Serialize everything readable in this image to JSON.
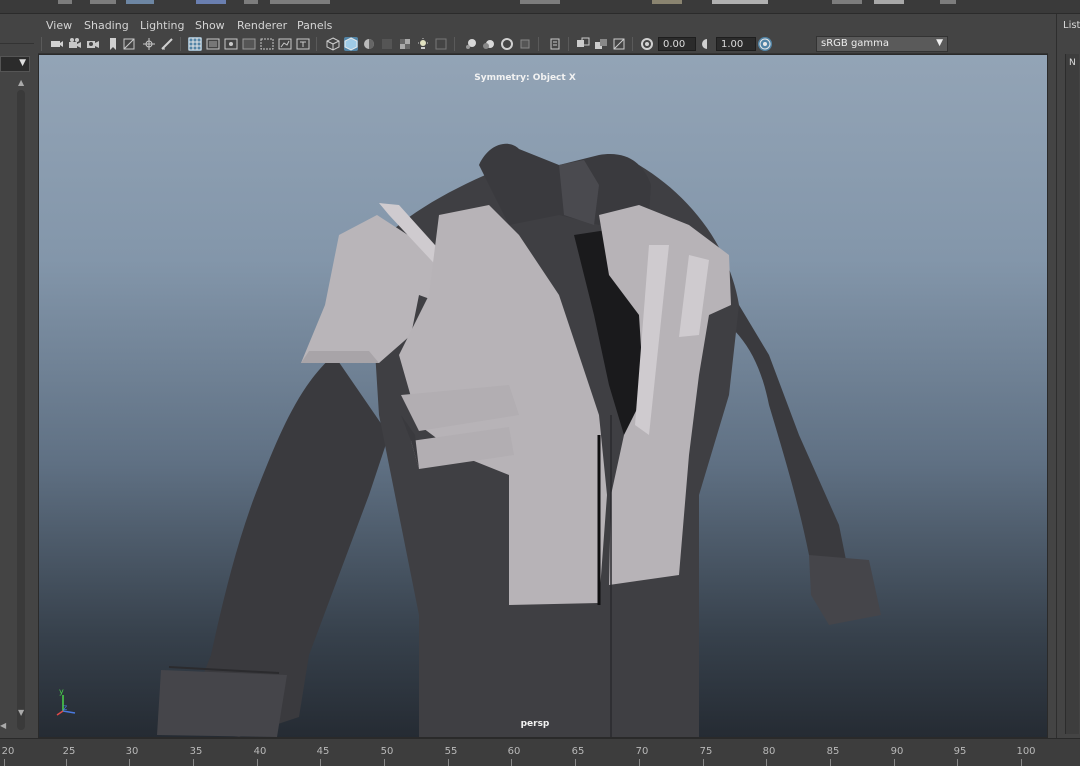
{
  "viewport_panel": {
    "menu": [
      "View",
      "Shading",
      "Lighting",
      "Show",
      "Renderer",
      "Panels"
    ],
    "toolbar": {
      "icons": [
        "select-camera-icon",
        "camera-attributes-icon",
        "bookmark-icon",
        "camera-icon",
        "image-plane-icon",
        "2d-pan-zoom-icon",
        "grease-pencil-icon",
        "grid-icon",
        "film-gate-icon",
        "resolution-gate-icon",
        "gate-mask-icon",
        "field-chart-icon",
        "safe-action-icon",
        "safe-title-icon",
        "wireframe-icon",
        "smooth-shade-icon",
        "default-lighting-icon",
        "textured-icon",
        "use-all-lights-icon",
        "shadows-icon",
        "screen-space-ao-icon",
        "motion-blur-icon",
        "multisample-aa-icon",
        "depth-of-field-icon",
        "isolate-select-icon",
        "xray-icon",
        "xray-joints-icon",
        "backface-culling-icon",
        "exposure-icon",
        "gamma-icon",
        "color-management-icon"
      ],
      "exposure_value": "0.00",
      "gamma_value": "1.00",
      "color_space": "sRGB gamma"
    },
    "symmetry_label": "Symmetry: Object X",
    "camera_label": "persp",
    "axis": {
      "y": "y",
      "z": "z"
    }
  },
  "right_panel": {
    "label": "List",
    "tab_letter": "N"
  },
  "timeline": {
    "ticks": [
      "20",
      "25",
      "30",
      "35",
      "40",
      "45",
      "50",
      "55",
      "60",
      "65",
      "70",
      "75",
      "80",
      "85",
      "90",
      "95",
      "100"
    ]
  },
  "colors": {
    "accent": "#5284a6",
    "viewport_top": "#93a4b6",
    "viewport_bottom": "#252b33",
    "jacket_dark": "#3f3f43",
    "armor_light": "#b9b5b9"
  }
}
